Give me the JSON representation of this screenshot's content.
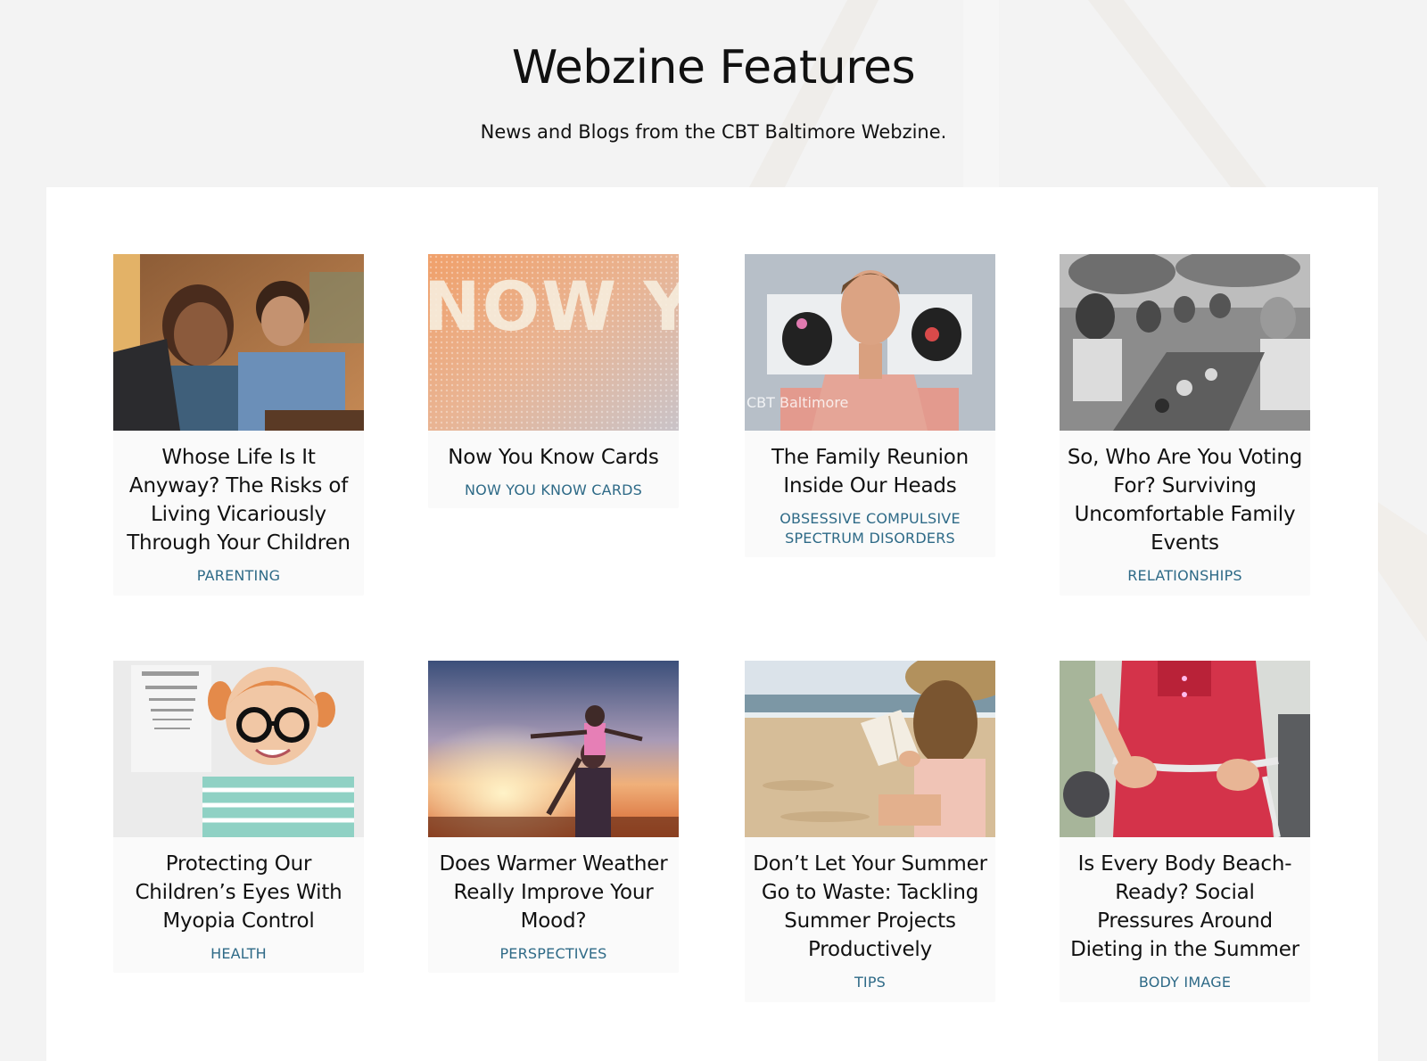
{
  "header": {
    "title": "Webzine Features",
    "subtitle": "News and Blogs from the CBT Baltimore Webzine."
  },
  "articles": [
    {
      "title": "Whose Life Is It Anyway? The Risks of Living Vicariously Through Your Children",
      "category": "PARENTING",
      "image": "mother-and-son-at-laptop-photo"
    },
    {
      "title": "Now You Know Cards",
      "category": "NOW YOU KNOW CARDS",
      "image": "now-you-know-dotted-lettering",
      "image_text": "NOW YOU KNOW"
    },
    {
      "title": "The Family Reunion Inside Our Heads",
      "category": "OBSESSIVE COMPULSIVE SPECTRUM DISORDERS",
      "image": "man-speaking-to-camera-photo",
      "image_text": "CBT Baltimore"
    },
    {
      "title": "So, Who Are You Voting For? Surviving Uncomfortable Family Events",
      "category": "RELATIONSHIPS",
      "image": "family-dinner-black-and-white-photo"
    },
    {
      "title": "Protecting Our Children’s Eyes With Myopia Control",
      "category": "HEALTH",
      "image": "girl-with-glasses-eye-chart-photo"
    },
    {
      "title": "Does Warmer Weather Really Improve Your Mood?",
      "category": "PERSPECTIVES",
      "image": "child-on-shoulders-sunset-photo"
    },
    {
      "title": "Don’t Let Your Summer Go to Waste: Tackling Summer Projects Productively",
      "category": "TIPS",
      "image": "woman-reading-on-beach-photo"
    },
    {
      "title": "Is Every Body Beach-Ready? Social Pressures Around Dieting in the Summer",
      "category": "BODY IMAGE",
      "image": "measuring-tape-waist-photo"
    }
  ],
  "colors": {
    "background": "#f3f3f3",
    "panel": "#ffffff",
    "card": "#fafafa",
    "category_link": "#2e6a87",
    "title_text": "#111111"
  }
}
